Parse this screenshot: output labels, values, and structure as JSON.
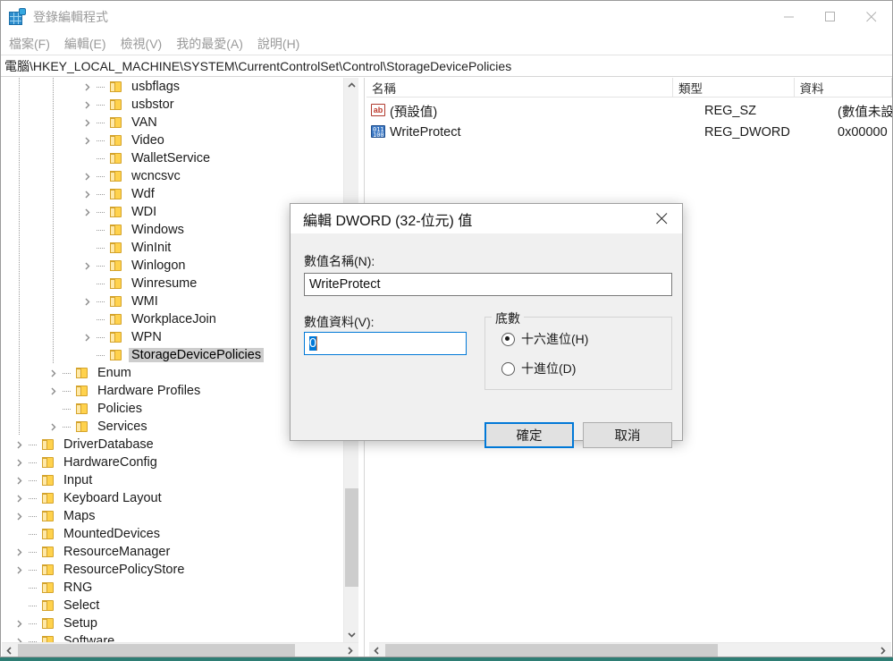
{
  "window": {
    "title": "登錄編輯程式",
    "icon": "regedit-icon",
    "controls": {
      "minimize": "minimize-icon",
      "maximize": "maximize-icon",
      "close": "close-icon"
    }
  },
  "menubar": {
    "items": [
      {
        "label": "檔案(F)"
      },
      {
        "label": "編輯(E)"
      },
      {
        "label": "檢視(V)"
      },
      {
        "label": "我的最愛(A)"
      },
      {
        "label": "說明(H)"
      }
    ]
  },
  "address": {
    "path": "電腦\\HKEY_LOCAL_MACHINE\\SYSTEM\\CurrentControlSet\\Control\\StorageDevicePolicies"
  },
  "tree": {
    "items": [
      {
        "label": "usbflags",
        "level": 3,
        "expandable": true,
        "selected": false
      },
      {
        "label": "usbstor",
        "level": 3,
        "expandable": true,
        "selected": false
      },
      {
        "label": "VAN",
        "level": 3,
        "expandable": true,
        "selected": false
      },
      {
        "label": "Video",
        "level": 3,
        "expandable": true,
        "selected": false
      },
      {
        "label": "WalletService",
        "level": 3,
        "expandable": false,
        "selected": false
      },
      {
        "label": "wcncsvc",
        "level": 3,
        "expandable": true,
        "selected": false
      },
      {
        "label": "Wdf",
        "level": 3,
        "expandable": true,
        "selected": false
      },
      {
        "label": "WDI",
        "level": 3,
        "expandable": true,
        "selected": false
      },
      {
        "label": "Windows",
        "level": 3,
        "expandable": false,
        "selected": false
      },
      {
        "label": "WinInit",
        "level": 3,
        "expandable": false,
        "selected": false
      },
      {
        "label": "Winlogon",
        "level": 3,
        "expandable": true,
        "selected": false
      },
      {
        "label": "Winresume",
        "level": 3,
        "expandable": false,
        "selected": false
      },
      {
        "label": "WMI",
        "level": 3,
        "expandable": true,
        "selected": false
      },
      {
        "label": "WorkplaceJoin",
        "level": 3,
        "expandable": false,
        "selected": false
      },
      {
        "label": "WPN",
        "level": 3,
        "expandable": true,
        "selected": false
      },
      {
        "label": "StorageDevicePolicies",
        "level": 3,
        "expandable": false,
        "selected": true
      },
      {
        "label": "Enum",
        "level": 2,
        "expandable": true,
        "selected": false
      },
      {
        "label": "Hardware Profiles",
        "level": 2,
        "expandable": true,
        "selected": false
      },
      {
        "label": "Policies",
        "level": 2,
        "expandable": false,
        "selected": false
      },
      {
        "label": "Services",
        "level": 2,
        "expandable": true,
        "selected": false
      },
      {
        "label": "DriverDatabase",
        "level": 1,
        "expandable": true,
        "selected": false
      },
      {
        "label": "HardwareConfig",
        "level": 1,
        "expandable": true,
        "selected": false
      },
      {
        "label": "Input",
        "level": 1,
        "expandable": true,
        "selected": false
      },
      {
        "label": "Keyboard Layout",
        "level": 1,
        "expandable": true,
        "selected": false
      },
      {
        "label": "Maps",
        "level": 1,
        "expandable": true,
        "selected": false
      },
      {
        "label": "MountedDevices",
        "level": 1,
        "expandable": false,
        "selected": false
      },
      {
        "label": "ResourceManager",
        "level": 1,
        "expandable": true,
        "selected": false
      },
      {
        "label": "ResourcePolicyStore",
        "level": 1,
        "expandable": true,
        "selected": false
      },
      {
        "label": "RNG",
        "level": 1,
        "expandable": false,
        "selected": false
      },
      {
        "label": "Select",
        "level": 1,
        "expandable": false,
        "selected": false
      },
      {
        "label": "Setup",
        "level": 1,
        "expandable": true,
        "selected": false
      },
      {
        "label": "Software",
        "level": 1,
        "expandable": true,
        "selected": false
      }
    ]
  },
  "values_pane": {
    "columns": [
      {
        "label": "名稱"
      },
      {
        "label": "類型"
      },
      {
        "label": "資料"
      }
    ],
    "rows": [
      {
        "name": "(預設值)",
        "icon": "string-value-icon",
        "type": "REG_SZ",
        "data": "(數值未設"
      },
      {
        "name": "WriteProtect",
        "icon": "dword-value-icon",
        "type": "REG_DWORD",
        "data": "0x00000"
      }
    ]
  },
  "dialog": {
    "title": "編輯 DWORD (32-位元) 值",
    "close_icon": "close-icon",
    "name_label": "數值名稱(N):",
    "name_value": "WriteProtect",
    "data_label": "數值資料(V):",
    "data_value": "0",
    "base_group_label": "底數",
    "radios": [
      {
        "label": "十六進位(H)",
        "checked": true
      },
      {
        "label": "十進位(D)",
        "checked": false
      }
    ],
    "ok_label": "確定",
    "cancel_label": "取消"
  },
  "scrollbars": {
    "tree_vertical": {
      "up": "chevron-up-icon",
      "down": "chevron-down-icon"
    },
    "tree_horizontal": {
      "left": "chevron-left-icon",
      "right": "chevron-right-icon"
    },
    "values_horizontal": {
      "left": "chevron-left-icon",
      "right": "chevron-right-icon"
    }
  },
  "colors": {
    "accent": "#0078d7",
    "selection_gray": "#cdcdcd",
    "folder": "#ffd24d",
    "dialog_bg": "#f0f0f0"
  }
}
